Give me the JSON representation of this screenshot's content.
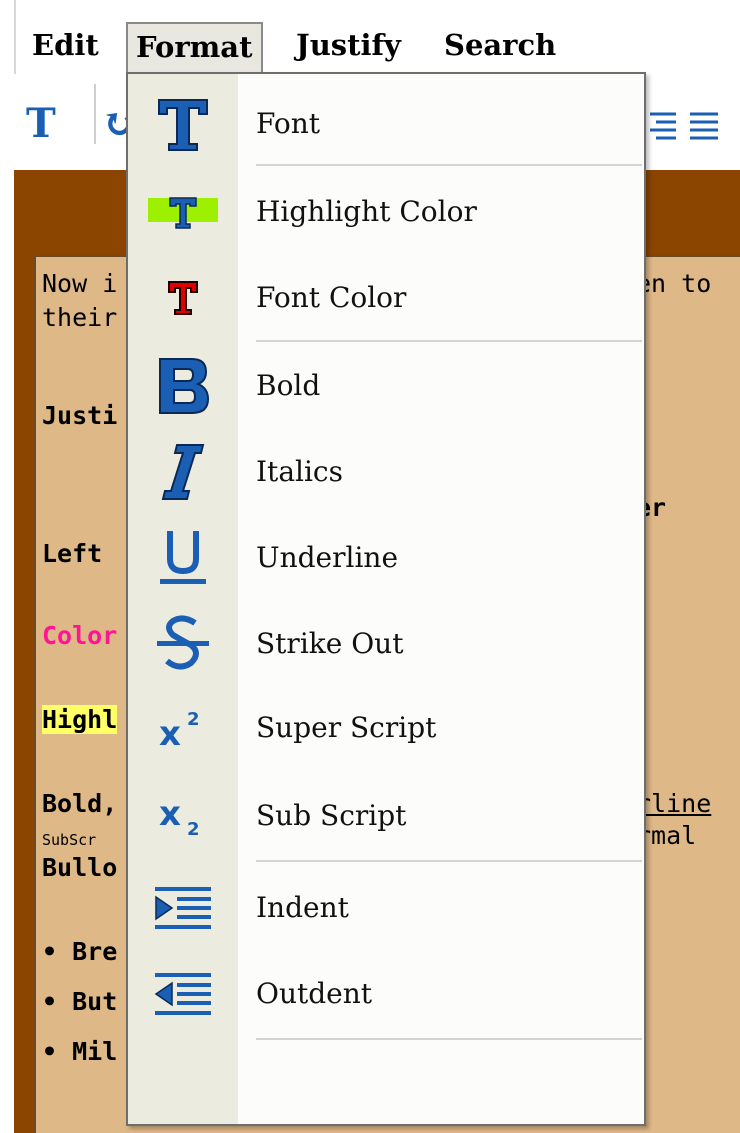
{
  "menubar": {
    "items": [
      "Edit",
      "Format",
      "Justify",
      "Search"
    ]
  },
  "document": {
    "lines": {
      "l1": "Now i",
      "l1b": "en to",
      "l2": "their",
      "l3": "Justi",
      "l4b": "er",
      "l5": "Left",
      "l6": "Color",
      "l7": "Highl",
      "l8": "Bold,",
      "l8b": "rline",
      "l9": "SubScr",
      "l9b": "rmal",
      "l10": "Bullo",
      "l11": "• Bre",
      "l12": "• But",
      "l13": "• Mil"
    }
  },
  "format_menu": {
    "items": [
      {
        "label": "Font",
        "icon": "font-icon"
      },
      {
        "label": "Highlight Color",
        "icon": "highlight-color-icon"
      },
      {
        "label": "Font Color",
        "icon": "font-color-icon"
      },
      {
        "label": "Bold",
        "icon": "bold-icon"
      },
      {
        "label": "Italics",
        "icon": "italics-icon"
      },
      {
        "label": "Underline",
        "icon": "underline-icon"
      },
      {
        "label": "Strike Out",
        "icon": "strike-out-icon"
      },
      {
        "label": "Super Script",
        "icon": "superscript-icon"
      },
      {
        "label": "Sub Script",
        "icon": "subscript-icon"
      },
      {
        "label": "Indent",
        "icon": "indent-icon"
      },
      {
        "label": "Outdent",
        "icon": "outdent-icon"
      }
    ]
  },
  "colors": {
    "icon_blue": "#1a5fb4",
    "highlight_green": "#9cf000",
    "font_red": "#e00000",
    "doc_background": "#deb887",
    "frame_brown": "#8b4500",
    "pink_text": "#ff1493",
    "yellow_highlight": "#ffff66"
  }
}
